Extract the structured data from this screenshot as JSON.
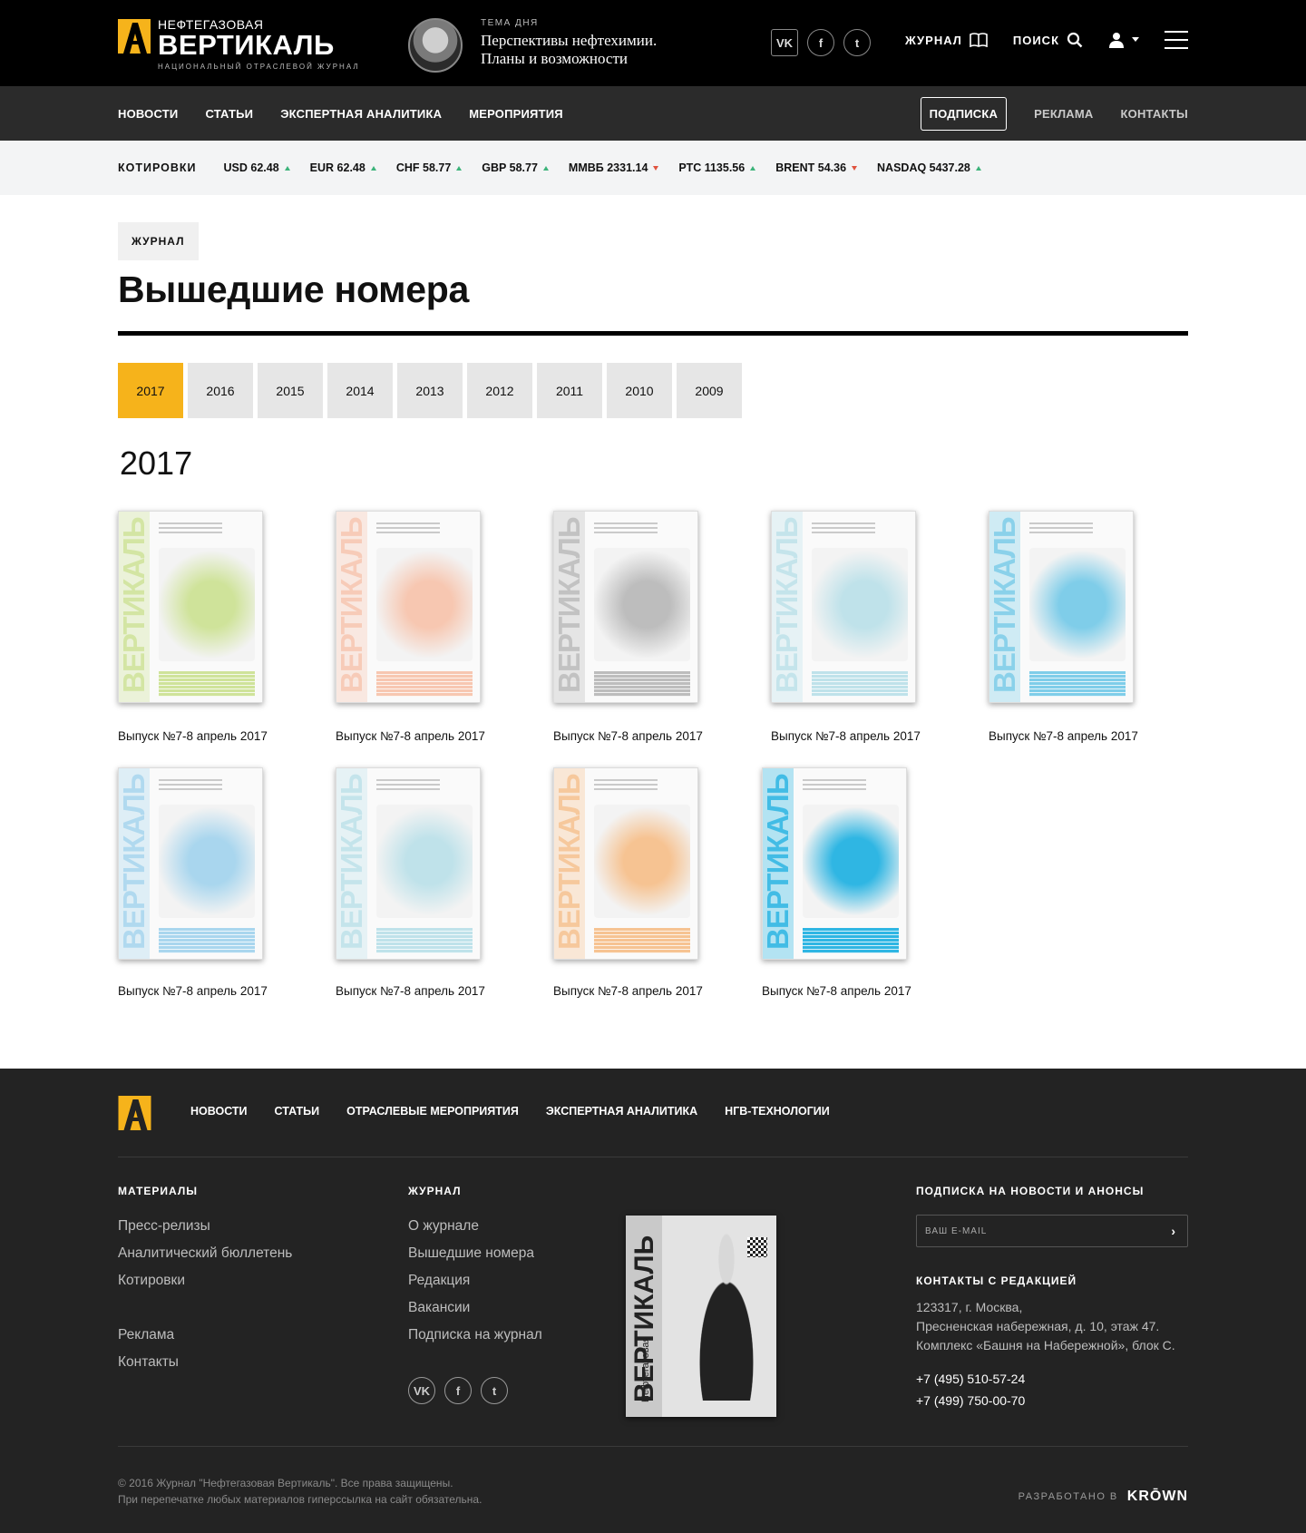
{
  "header": {
    "logo_small": "НЕФТЕГАЗОВАЯ",
    "logo_big": "ВЕРТИКАЛЬ",
    "logo_sub": "НАЦИОНАЛЬНЫЙ ОТРАСЛЕВОЙ ЖУРНАЛ",
    "theme_label": "ТЕМА ДНЯ",
    "theme_title_1": "Перспективы нефтехимии.",
    "theme_title_2": "Планы и возможности",
    "socials": [
      {
        "icon": "vk-icon",
        "glyph": "VK"
      },
      {
        "icon": "facebook-icon",
        "glyph": "f"
      },
      {
        "icon": "twitter-icon",
        "glyph": "t"
      }
    ],
    "journal_label": "ЖУРНАЛ",
    "search_label": "ПОИСК"
  },
  "nav": {
    "left": [
      "НОВОСТИ",
      "СТАТЬИ",
      "ЭКСПЕРТНАЯ АНАЛИТИКА",
      "МЕРОПРИЯТИЯ"
    ],
    "subscribe": "ПОДПИСКА",
    "ads": "РЕКЛАМА",
    "contacts": "КОНТАКТЫ"
  },
  "quotes": {
    "label": "КОТИРОВКИ",
    "items": [
      {
        "text": "USD 62.48",
        "dir": "up"
      },
      {
        "text": "EUR 62.48",
        "dir": "up"
      },
      {
        "text": "CHF 58.77",
        "dir": "up"
      },
      {
        "text": "GBP 58.77",
        "dir": "up"
      },
      {
        "text": "ММВБ 2331.14",
        "dir": "down"
      },
      {
        "text": "РТС 1135.56",
        "dir": "up"
      },
      {
        "text": "BRENT 54.36",
        "dir": "down"
      },
      {
        "text": "NASDAQ 5437.28",
        "dir": "up"
      }
    ]
  },
  "page": {
    "crumb": "ЖУРНАЛ",
    "title": "Вышедшие номера",
    "years": [
      "2017",
      "2016",
      "2015",
      "2014",
      "2013",
      "2012",
      "2011",
      "2010",
      "2009"
    ],
    "active_year": "2017",
    "year_heading": "2017"
  },
  "issues": [
    {
      "caption": "Выпуск №7-8 апрель 2017",
      "color": "#cfe39a"
    },
    {
      "caption": "Выпуск №7-8 апрель 2017",
      "color": "#f7c7b1"
    },
    {
      "caption": "Выпуск №7-8 апрель 2017",
      "color": "#bdbdbd"
    },
    {
      "caption": "Выпуск №7-8 апрель 2017",
      "color": "#bfe2ea"
    },
    {
      "caption": "Выпуск №7-8 апрель 2017",
      "color": "#7fcde9"
    },
    {
      "caption": "Выпуск №7-8 апрель 2017",
      "color": "#a9d6ee"
    },
    {
      "caption": "Выпуск №7-8 апрель 2017",
      "color": "#bfe2ea"
    },
    {
      "caption": "Выпуск №7-8 апрель 2017",
      "color": "#f6c392"
    },
    {
      "caption": "Выпуск №7-8 апрель 2017",
      "color": "#2fb6e3"
    }
  ],
  "footer": {
    "nav": [
      "НОВОСТИ",
      "СТАТЬИ",
      "ОТРАСЛЕВЫЕ МЕРОПРИЯТИЯ",
      "ЭКСПЕРТНАЯ АНАЛИТИКА",
      "НГВ-ТЕХНОЛОГИИ"
    ],
    "materials_title": "МАТЕРИАЛЫ",
    "materials": [
      "Пресс-релизы",
      "Аналитический бюллетень",
      "Котировки",
      "Реклама",
      "Контакты"
    ],
    "journal_title": "ЖУРНАЛ",
    "journal_links": [
      "О журнале",
      "Вышедшие номера",
      "Редакция",
      "Вакансии",
      "Подписка на журнал"
    ],
    "cover_word_small": "Нефтегазовая",
    "cover_word_big": "ВЕРТИКАЛЬ",
    "subscribe_title": "ПОДПИСКА НА НОВОСТИ И АНОНСЫ",
    "email_placeholder": "ВАШ E-MAIL",
    "contacts_title": "КОНТАКТЫ С РЕДАКЦИЕЙ",
    "address_1": "123317, г. Москва,",
    "address_2": "Пресненская набережная, д. 10, этаж 47.",
    "address_3": "Комплекс «Башня на Набережной», блок С.",
    "phone_1": "+7 (495) 510-57-24",
    "phone_2": "+7 (499) 750-00-70",
    "copyright_1": "© 2016 Журнал \"Нефтегазовая Вертикаль\". Все права защищены.",
    "copyright_2": "При перепечатке любых материалов гиперссылка на сайт обязательна.",
    "dev_label": "РАЗРАБОТАНО В",
    "dev_brand": "KRŌWN"
  },
  "colors": {
    "accent": "#f6b31b",
    "topbar": "#000000",
    "navbar": "#2b2b2b",
    "footer": "#232323"
  }
}
